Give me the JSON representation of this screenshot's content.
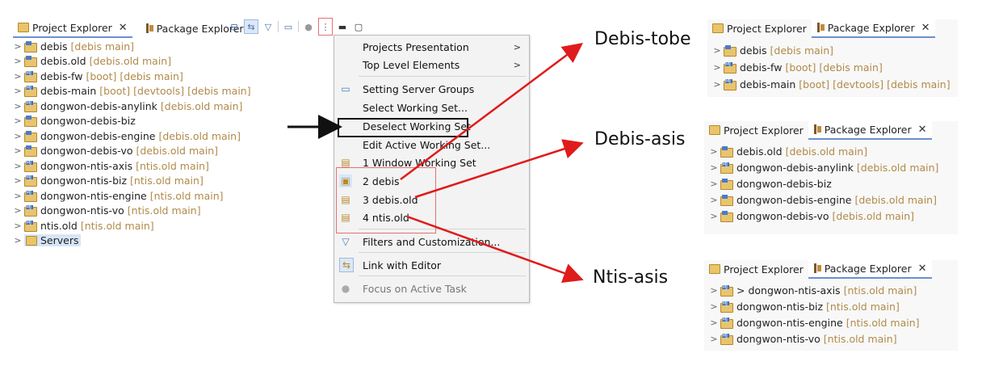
{
  "main": {
    "tabs": [
      {
        "label": "Project Explorer",
        "active": true,
        "closable": true
      },
      {
        "label": "Package Explorer",
        "active": false,
        "closable": false
      }
    ],
    "tree": [
      {
        "name": "debis",
        "meta": "[debis main]"
      },
      {
        "name": "debis.old",
        "meta": "[debis.old main]"
      },
      {
        "name": "debis-fw",
        "meta": "[boot] [debis main]"
      },
      {
        "name": "debis-main",
        "meta": "[boot] [devtools] [debis main]"
      },
      {
        "name": "dongwon-debis-anylink",
        "meta": "[debis.old main]"
      },
      {
        "name": "dongwon-debis-biz",
        "meta": ""
      },
      {
        "name": "dongwon-debis-engine",
        "meta": "[debis.old main]"
      },
      {
        "name": "dongwon-debis-vo",
        "meta": "[debis.old main]"
      },
      {
        "name": "dongwon-ntis-axis",
        "meta": "[ntis.old main]"
      },
      {
        "name": "dongwon-ntis-biz",
        "meta": "[ntis.old main]"
      },
      {
        "name": "dongwon-ntis-engine",
        "meta": "[ntis.old main]"
      },
      {
        "name": "dongwon-ntis-vo",
        "meta": "[ntis.old main]"
      },
      {
        "name": "ntis.old",
        "meta": "[ntis.old main]"
      },
      {
        "name": "Servers",
        "meta": ""
      }
    ]
  },
  "menu": {
    "items": [
      {
        "label": "Projects Presentation",
        "submenu": true
      },
      {
        "label": "Top Level Elements",
        "submenu": true
      },
      {
        "label": "Setting Server Groups"
      },
      {
        "label": "Select Working Set..."
      },
      {
        "label": "Deselect Working Set"
      },
      {
        "label": "Edit Active Working Set..."
      },
      {
        "label": "1 Window Working Set"
      },
      {
        "label": "2 debis"
      },
      {
        "label": "3 debis.old"
      },
      {
        "label": "4 ntis.old"
      },
      {
        "label": "Filters and Customization..."
      },
      {
        "label": "Link with Editor"
      },
      {
        "label": "Focus on Active Task"
      }
    ]
  },
  "callouts": {
    "tobe": "Debis-tobe",
    "asis": "Debis-asis",
    "ntis": "Ntis-asis"
  },
  "panels": [
    {
      "tabs": [
        "Project Explorer",
        "Package Explorer"
      ],
      "rows": [
        {
          "name": "debis",
          "meta": "[debis main]"
        },
        {
          "name": "debis-fw",
          "meta": "[boot] [debis main]"
        },
        {
          "name": "debis-main",
          "meta": "[boot] [devtools] [debis main]"
        }
      ]
    },
    {
      "tabs": [
        "Project Explorer",
        "Package Explorer"
      ],
      "rows": [
        {
          "name": "debis.old",
          "meta": "[debis.old main]"
        },
        {
          "name": "dongwon-debis-anylink",
          "meta": "[debis.old main]"
        },
        {
          "name": "dongwon-debis-biz",
          "meta": ""
        },
        {
          "name": "dongwon-debis-engine",
          "meta": "[debis.old main]"
        },
        {
          "name": "dongwon-debis-vo",
          "meta": "[debis.old main]"
        }
      ]
    },
    {
      "tabs": [
        "Project Explorer",
        "Package Explorer"
      ],
      "rows": [
        {
          "name": "> dongwon-ntis-axis",
          "meta": "[ntis.old main]"
        },
        {
          "name": "dongwon-ntis-biz",
          "meta": "[ntis.old main]"
        },
        {
          "name": "dongwon-ntis-engine",
          "meta": "[ntis.old main]"
        },
        {
          "name": "dongwon-ntis-vo",
          "meta": "[ntis.old main]"
        }
      ]
    }
  ],
  "colors": {
    "annotation_red": "#e01b1b",
    "meta_text": "#b08a4a",
    "selection": "#d6e6f8"
  }
}
